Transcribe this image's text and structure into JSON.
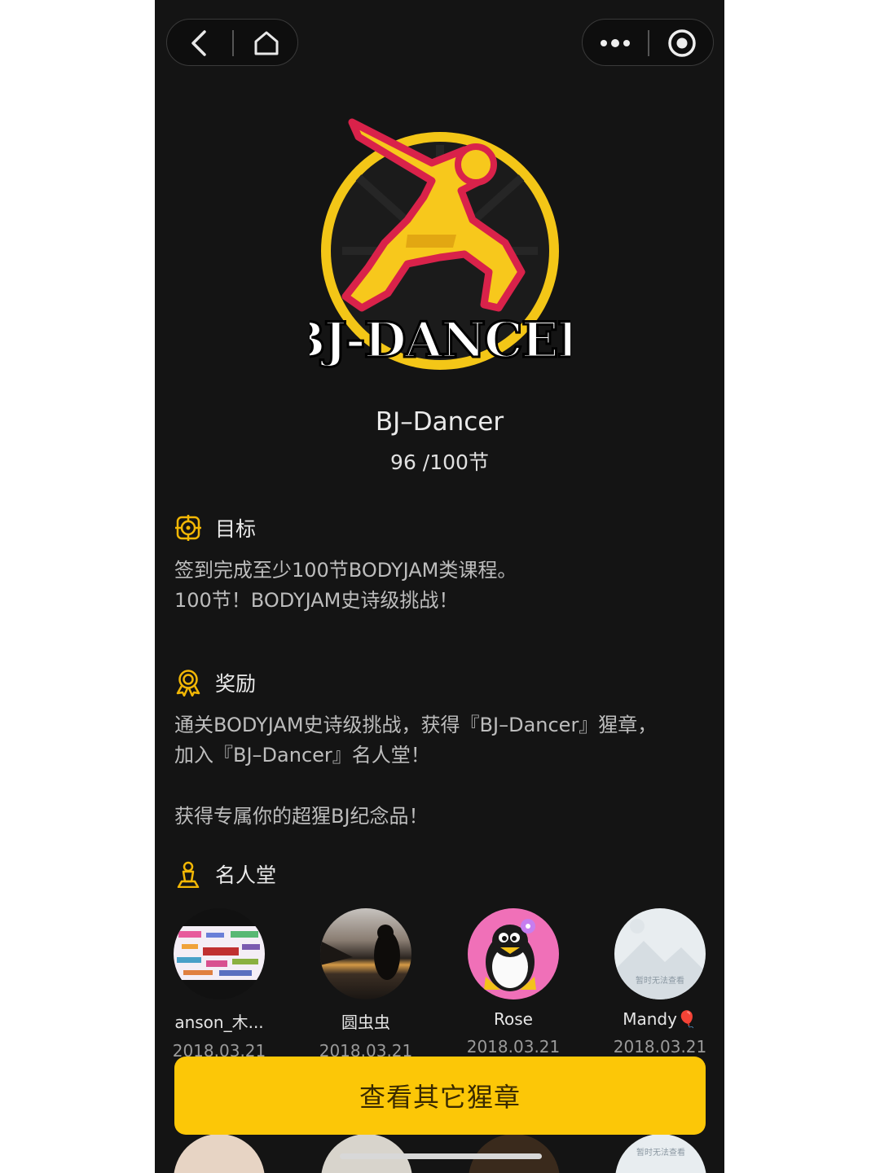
{
  "nav": {
    "back_icon": "chevron-left-icon",
    "home_icon": "home-icon",
    "more_icon": "more-dots-icon",
    "target_icon": "record-circle-icon"
  },
  "badge": {
    "logo_text": "BJ-DANCER",
    "colors": {
      "yellow": "#f7c81c",
      "red": "#d9224a",
      "ring": "#f3c617"
    }
  },
  "header": {
    "title": "BJ–Dancer",
    "progress": "96  /100节"
  },
  "goal": {
    "icon": "target-icon",
    "heading": "目标",
    "lines": [
      "签到完成至少100节BODYJAM类课程。",
      "100节！BODYJAM史诗级挑战！"
    ]
  },
  "reward": {
    "icon": "award-ribbon-icon",
    "heading": "奖励",
    "lines": [
      "通关BODYJAM史诗级挑战，获得『BJ–Dancer』猩章，",
      "加入『BJ–Dancer』名人堂！"
    ],
    "extra": "获得专属你的超猩BJ纪念品！"
  },
  "hall_of_fame": {
    "icon": "trophy-icon",
    "heading": "名人堂",
    "members": [
      {
        "name": "anson_木...",
        "date": "2018.03.21"
      },
      {
        "name": "圆虫虫",
        "date": "2018.03.21"
      },
      {
        "name": "Rose",
        "date": "2018.03.21"
      },
      {
        "name": "Mandy🎈",
        "date": "2018.03.21",
        "avatar_text": "暂时无法查看"
      }
    ]
  },
  "cta": {
    "label": "查看其它猩章"
  },
  "peek": {
    "avatar_text": "暂时无法查看"
  },
  "theme": {
    "background": "#141414",
    "accent": "#fcc707"
  }
}
